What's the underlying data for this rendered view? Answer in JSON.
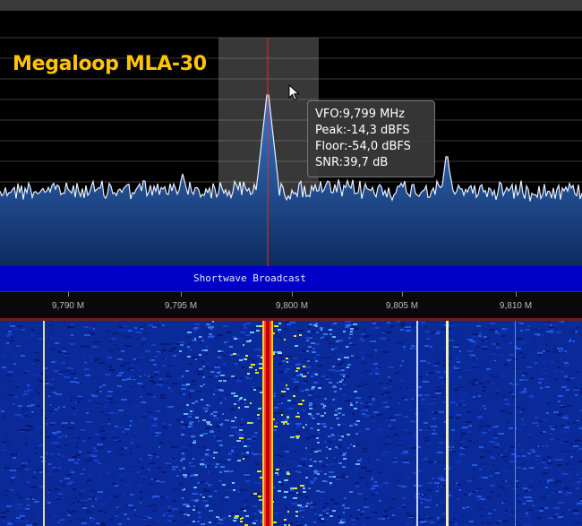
{
  "overlay_title": "Megaloop MLA-30",
  "tooltip": {
    "vfo": "VFO:9,799 MHz",
    "peak": "Peak:-14,3 dBFS",
    "floor": "Floor:-54,0 dBFS",
    "snr": "SNR:39,7 dB"
  },
  "band_label": "Shortwave Broadcast",
  "axis": {
    "ticks": [
      "9,790 M",
      "9,795 M",
      "9,800 M",
      "9,805 M",
      "9,810 M"
    ]
  },
  "colors": {
    "band_bar": "#0000c8",
    "title": "#ffc400",
    "vfo_line": "#ff2020",
    "spectrum_fill": "#1e4e9a",
    "waterfall_bg": "#0a2a9a"
  },
  "icons": {
    "cursor": "mouse-pointer-icon"
  }
}
